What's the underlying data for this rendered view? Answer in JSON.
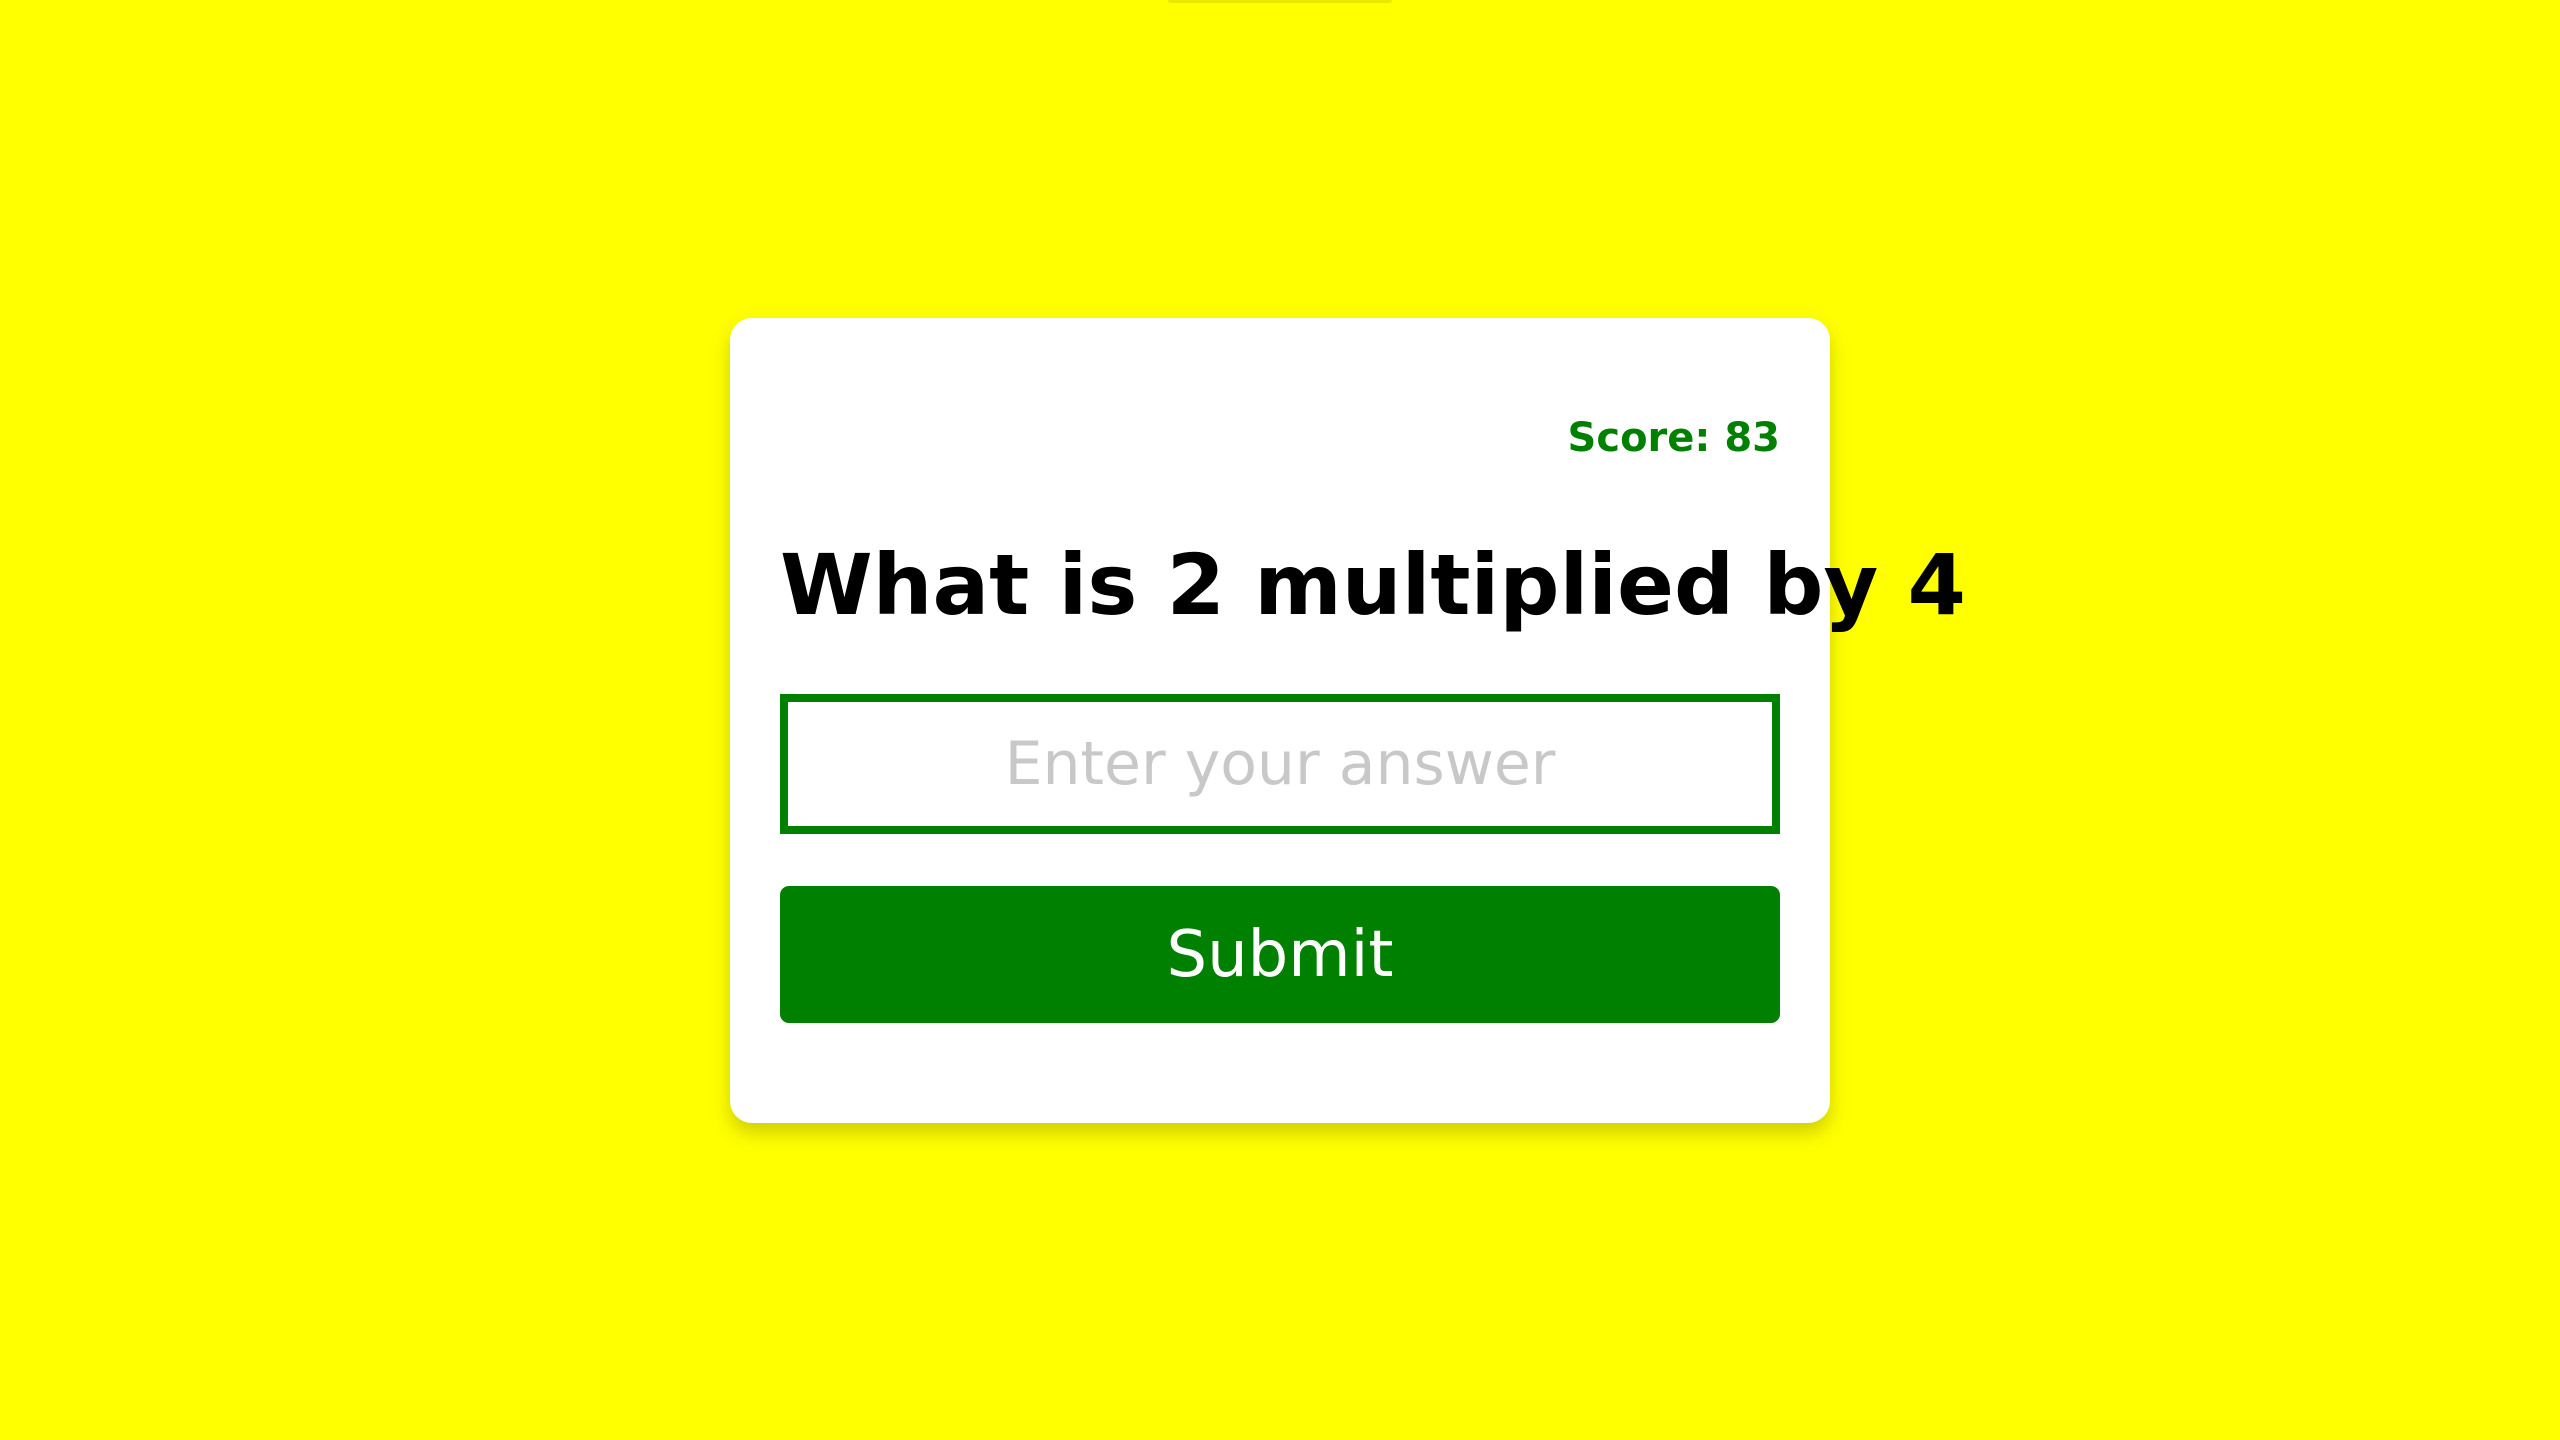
{
  "quiz": {
    "score_label": "Score: 83",
    "question": "What is 2 multiplied by 4",
    "answer_placeholder": "Enter your answer",
    "answer_value": "",
    "submit_label": "Submit"
  },
  "colors": {
    "background": "#ffff00",
    "card": "#ffffff",
    "accent": "#008000",
    "question_text": "#000000",
    "placeholder": "#c8c8c8"
  }
}
